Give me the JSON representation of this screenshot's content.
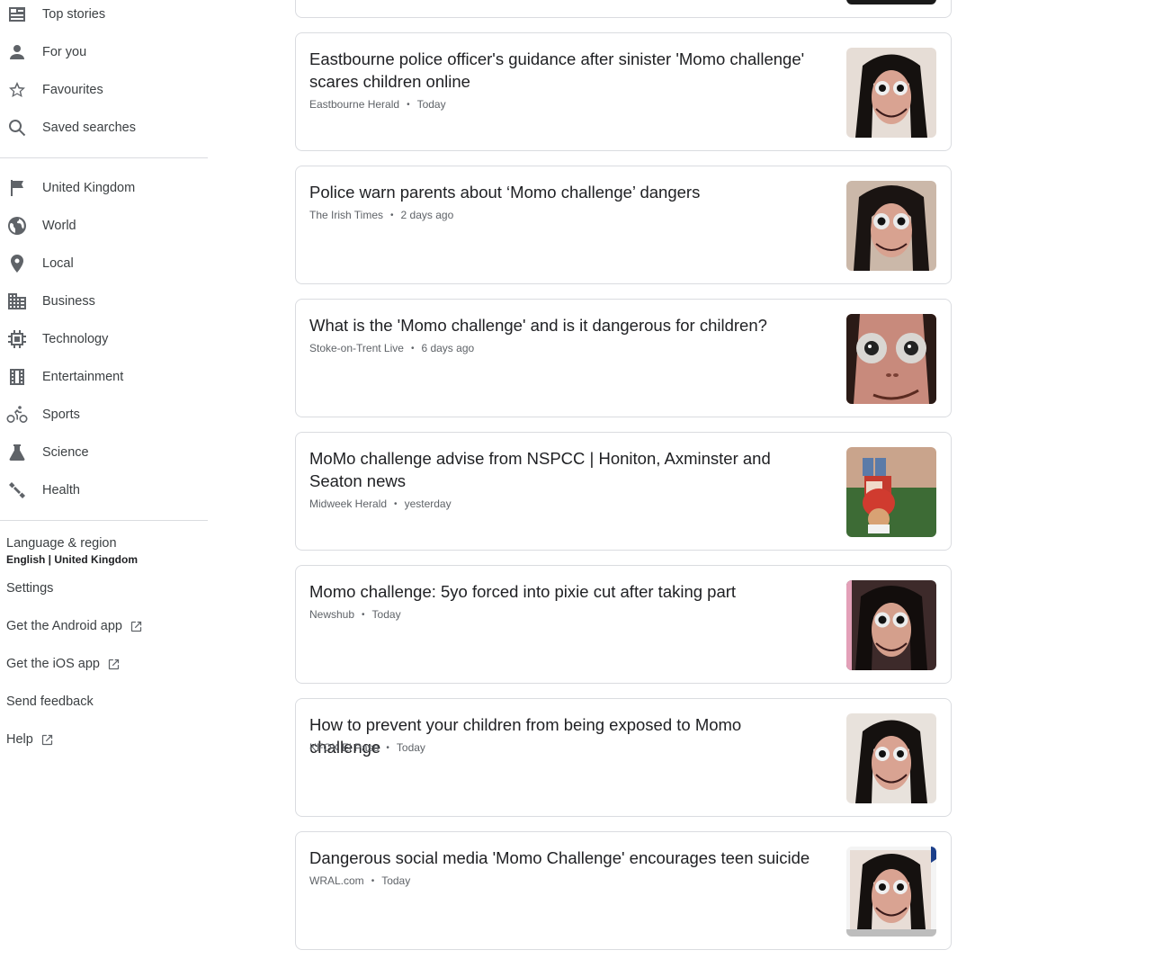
{
  "sidebar": {
    "nav_top": [
      {
        "label": "Top stories",
        "icon": "newspaper-icon"
      },
      {
        "label": "For you",
        "icon": "person-icon"
      },
      {
        "label": "Favourites",
        "icon": "star-icon"
      },
      {
        "label": "Saved searches",
        "icon": "search-icon"
      }
    ],
    "nav_topics": [
      {
        "label": "United Kingdom",
        "icon": "flag-icon"
      },
      {
        "label": "World",
        "icon": "globe-icon"
      },
      {
        "label": "Local",
        "icon": "location-pin-icon"
      },
      {
        "label": "Business",
        "icon": "building-icon"
      },
      {
        "label": "Technology",
        "icon": "chip-icon"
      },
      {
        "label": "Entertainment",
        "icon": "film-icon"
      },
      {
        "label": "Sports",
        "icon": "bicycle-icon"
      },
      {
        "label": "Science",
        "icon": "flask-icon"
      },
      {
        "label": "Health",
        "icon": "dumbbell-icon"
      }
    ],
    "footer": {
      "language_label": "Language & region",
      "language_value": "English | United Kingdom",
      "settings": "Settings",
      "android_app": "Get the Android app",
      "ios_app": "Get the iOS app",
      "feedback": "Send feedback",
      "help": "Help"
    }
  },
  "articles": [
    {
      "title": "Eastbourne police officer's guidance after sinister 'Momo challenge' scares children online",
      "source": "Eastbourne Herald",
      "time": "Today",
      "thumb": "momo-face"
    },
    {
      "title": "Police warn parents about ‘Momo challenge’ dangers",
      "source": "The Irish Times",
      "time": "2 days ago",
      "thumb": "momo-face"
    },
    {
      "title": "What is the 'Momo challenge' and is it dangerous for children?",
      "source": "Stoke-on-Trent Live",
      "time": "6 days ago",
      "thumb": "momo-closeup"
    },
    {
      "title": "MoMo challenge advise from NSPCC | Honiton, Axminster and Seaton news",
      "source": "Midweek Herald",
      "time": "yesterday",
      "thumb": "child-tablet"
    },
    {
      "title": "Momo challenge: 5yo forced into pixie cut after taking part",
      "source": "Newshub",
      "time": "Today",
      "thumb": "momo-face"
    },
    {
      "title": "How to prevent your children from being exposed to Momo challenge",
      "source": "KFOX El Paso",
      "time": "Today",
      "thumb": "momo-face"
    },
    {
      "title": "Dangerous social media 'Momo Challenge' encourages teen suicide",
      "source": "WRAL.com",
      "time": "Today",
      "thumb": "momo-face"
    }
  ]
}
